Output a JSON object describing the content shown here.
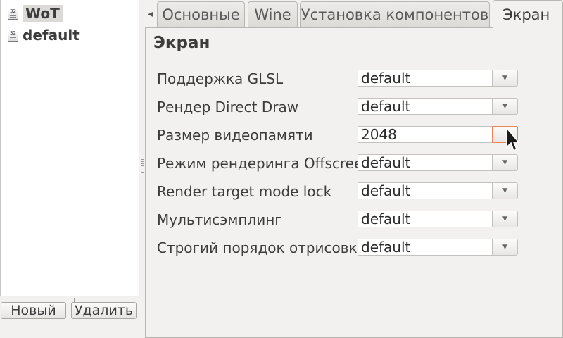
{
  "sidebar": {
    "items": [
      {
        "label": "WoT",
        "icon": "32",
        "selected": true
      },
      {
        "label": "default",
        "icon": "32",
        "selected": false
      }
    ],
    "new_button": "Новый",
    "delete_button": "Удалить"
  },
  "tabs": [
    {
      "label": "Основные",
      "active": false
    },
    {
      "label": "Wine",
      "active": false
    },
    {
      "label": "Установка компонентов",
      "active": false
    },
    {
      "label": "Экран",
      "active": true
    }
  ],
  "section": {
    "title": "Экран",
    "settings": [
      {
        "label": "Поддержка GLSL",
        "value": "default"
      },
      {
        "label": "Рендер Direct Draw",
        "value": "default"
      },
      {
        "label": "Размер видеопамяти",
        "value": "2048"
      },
      {
        "label": "Режим рендеринга Offscreen",
        "value": "default"
      },
      {
        "label": "Render target mode lock",
        "value": "default"
      },
      {
        "label": "Мультисэмплинг",
        "value": "default"
      },
      {
        "label": "Строгий порядок отрисовки",
        "value": "default"
      }
    ]
  },
  "colors": {
    "focus_border": "#e9875a"
  }
}
